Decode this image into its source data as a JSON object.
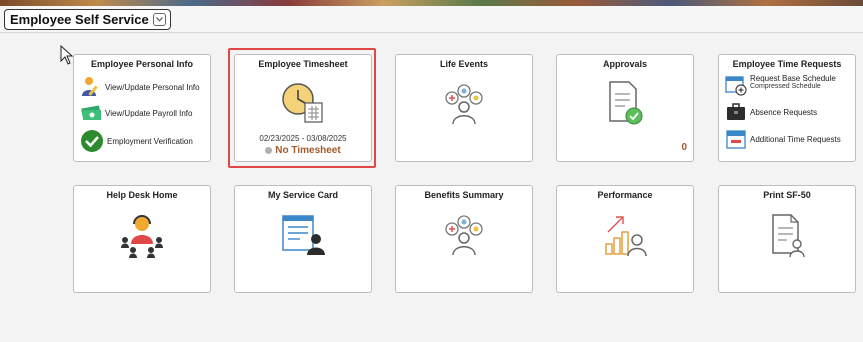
{
  "header": {
    "title": "Employee Self Service"
  },
  "colors": {
    "highlight": "#e04848",
    "accent_orange": "#a35a2a",
    "icon_blue": "#3a87c8"
  },
  "tiles": {
    "personal_info": {
      "title": "Employee Personal Info",
      "items": [
        {
          "label": "View/Update Personal Info",
          "icon": "person-pencil-icon"
        },
        {
          "label": "View/Update Payroll Info",
          "icon": "money-icon"
        },
        {
          "label": "Employment Verification",
          "icon": "checkmark-icon"
        }
      ]
    },
    "timesheet": {
      "title": "Employee Timesheet",
      "dates": "02/23/2025 - 03/08/2025",
      "status": "No Timesheet",
      "icon": "clock-calendar-icon"
    },
    "life_events": {
      "title": "Life Events",
      "icon": "life-events-icon"
    },
    "approvals": {
      "title": "Approvals",
      "count": "0",
      "icon": "document-check-icon"
    },
    "time_requests": {
      "title": "Employee Time Requests",
      "items": [
        {
          "label": "Request Base Schedule",
          "sub": "Compressed Schedule",
          "icon": "calendar-plus-icon"
        },
        {
          "label": "Absence Requests",
          "icon": "briefcase-icon"
        },
        {
          "label": "Additional Time Requests",
          "icon": "calendar-icon"
        }
      ]
    },
    "help_desk": {
      "title": "Help Desk Home",
      "icon": "help-desk-icon"
    },
    "service_card": {
      "title": "My Service Card",
      "icon": "service-card-icon"
    },
    "benefits": {
      "title": "Benefits Summary",
      "icon": "benefits-icon"
    },
    "performance": {
      "title": "Performance",
      "icon": "performance-icon"
    },
    "sf50": {
      "title": "Print SF-50",
      "icon": "print-document-icon"
    }
  }
}
